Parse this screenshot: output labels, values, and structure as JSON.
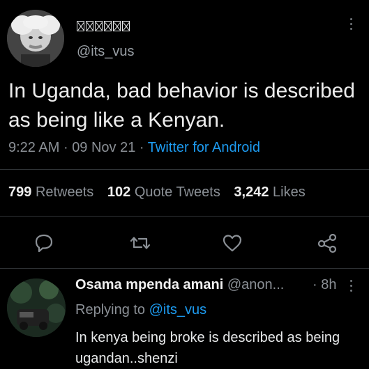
{
  "tweet": {
    "display_name_glyph_count": 6,
    "handle": "@its_vus",
    "text": "In Uganda, bad behavior is described as being like a Kenyan.",
    "time": "9:22 AM",
    "dot": "·",
    "date": "09 Nov 21",
    "source": "Twitter for Android"
  },
  "stats": {
    "retweets_count": "799",
    "retweets_label": "Retweets",
    "quotes_count": "102",
    "quotes_label": "Quote Tweets",
    "likes_count": "3,242",
    "likes_label": "Likes"
  },
  "actions": {
    "reply_icon": "comment-icon",
    "retweet_icon": "retweet-icon",
    "like_icon": "heart-icon",
    "share_icon": "share-icon"
  },
  "reply": {
    "name": "Osama mpenda amani",
    "handle": "@anon...",
    "dot": "·",
    "time": "8h",
    "replying_prefix": "Replying to",
    "replying_to": "@its_vus",
    "text": "In kenya being broke is described as being ugandan..shenzi"
  },
  "colors": {
    "background": "#000000",
    "accent": "#1d9bf0",
    "muted": "#8b9096",
    "separator": "#2f3336"
  }
}
